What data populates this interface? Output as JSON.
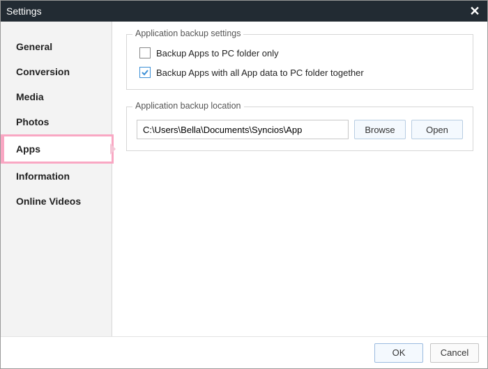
{
  "window": {
    "title": "Settings"
  },
  "sidebar": {
    "items": [
      {
        "label": "General"
      },
      {
        "label": "Conversion"
      },
      {
        "label": "Media"
      },
      {
        "label": "Photos"
      },
      {
        "label": "Apps"
      },
      {
        "label": "Information"
      },
      {
        "label": "Online Videos"
      }
    ],
    "active_index": 4
  },
  "settings_group": {
    "legend": "Application backup settings",
    "option_pc_only": {
      "label": "Backup Apps to PC folder only",
      "checked": false
    },
    "option_with_data": {
      "label": "Backup Apps with all App data to PC folder together",
      "checked": true
    }
  },
  "location_group": {
    "legend": "Application backup location",
    "path": "C:\\Users\\Bella\\Documents\\Syncios\\App",
    "browse_label": "Browse",
    "open_label": "Open"
  },
  "footer": {
    "ok_label": "OK",
    "cancel_label": "Cancel"
  }
}
